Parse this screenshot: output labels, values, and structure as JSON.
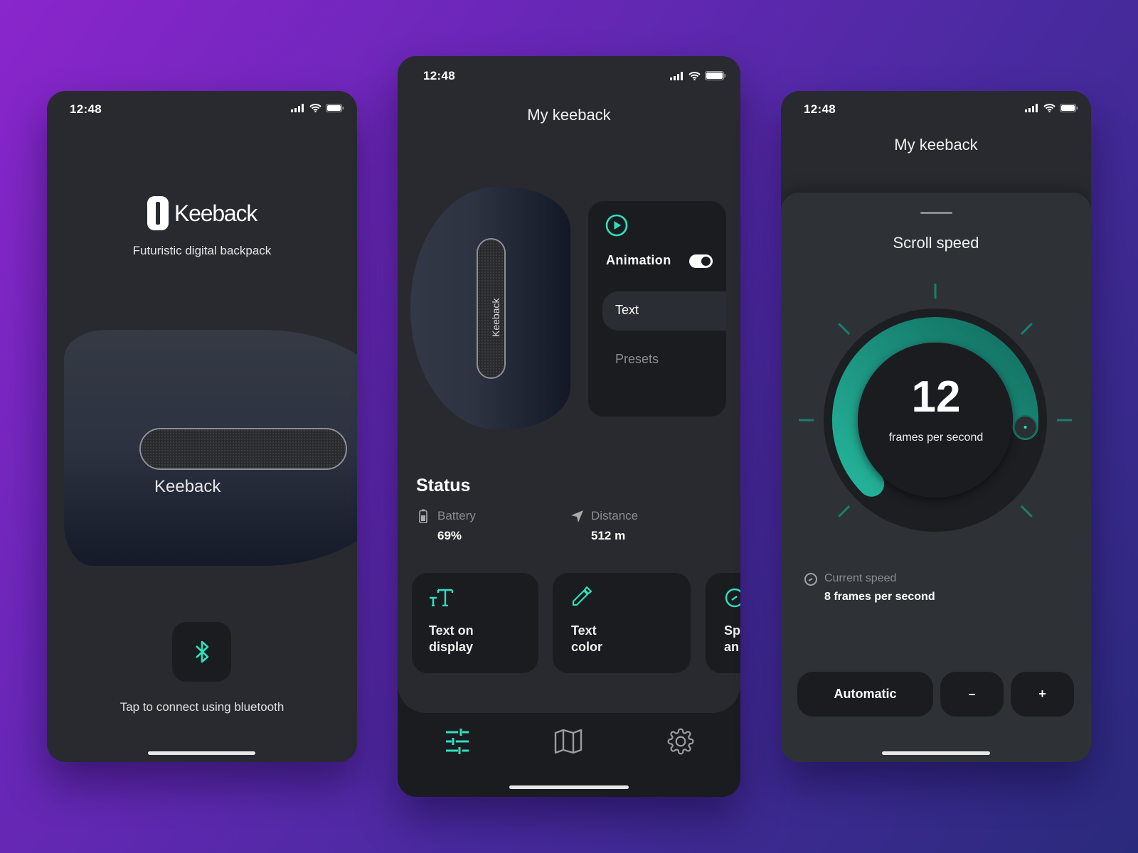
{
  "status_bar": {
    "time": "12:48"
  },
  "colors": {
    "accent": "#2de0c0",
    "phone_bg": "#282a30",
    "card_bg": "#1b1c20"
  },
  "welcome": {
    "brand": "Keeback",
    "tagline": "Futuristic digital backpack",
    "device_label": "Keeback",
    "bluetooth_icon": "bluetooth-icon",
    "connect_hint": "Tap to connect using bluetooth"
  },
  "dashboard": {
    "title": "My keeback",
    "device_label": "Keeback",
    "mode_panel": {
      "animation_label": "Animation",
      "animation_enabled": true,
      "text_label": "Text",
      "presets_label": "Presets"
    },
    "status": {
      "heading": "Status",
      "battery_label": "Battery",
      "battery_value": "69%",
      "distance_label": "Distance",
      "distance_value": "512 m"
    },
    "cards": [
      {
        "icon": "text-size-icon",
        "line1": "Text on",
        "line2": "display"
      },
      {
        "icon": "eyedropper-icon",
        "line1": "Text",
        "line2": "color"
      },
      {
        "icon": "speedometer-icon",
        "line1": "Sp",
        "line2": "an"
      }
    ],
    "tabs": [
      {
        "icon": "sliders-icon",
        "active": true
      },
      {
        "icon": "map-icon",
        "active": false
      },
      {
        "icon": "gear-icon",
        "active": false
      }
    ]
  },
  "scroll": {
    "title": "My keeback",
    "sheet_title": "Scroll speed",
    "value": "12",
    "unit": "frames per second",
    "dial_fraction": 0.85,
    "current_label": "Current speed",
    "current_value": "8 frames per second",
    "automatic_label": "Automatic",
    "minus_label": "–",
    "plus_label": "+"
  }
}
